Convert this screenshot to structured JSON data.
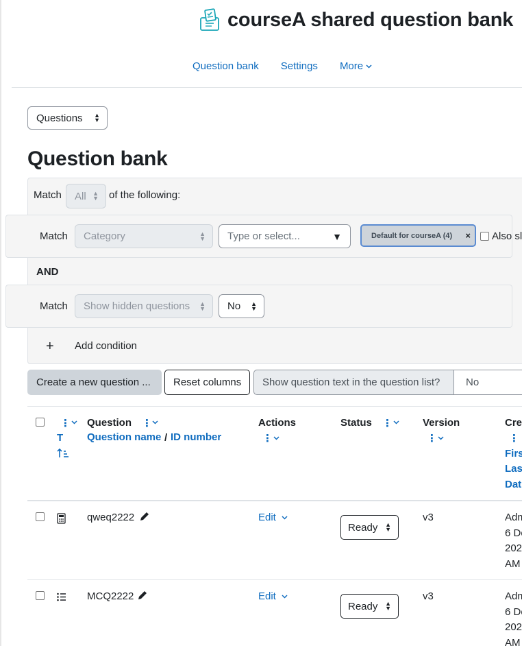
{
  "header": {
    "title": "courseA shared question bank",
    "logo_icon": "question-bank-box-icon"
  },
  "secondary_nav": {
    "items": [
      "Question bank",
      "Settings"
    ],
    "more_label": "More"
  },
  "page_select": {
    "value": "Questions"
  },
  "section_title": "Question bank",
  "filters": {
    "match_label": "Match",
    "match_value": "All",
    "of_following": "of the following:",
    "condition1": {
      "match": "Match",
      "type": "Category",
      "typeahead_placeholder": "Type or select...",
      "chip": "Default for courseA (4)",
      "also_show": "Also sl"
    },
    "join": "AND",
    "condition2": {
      "match": "Match",
      "type": "Show hidden questions",
      "value": "No"
    },
    "add_condition_label": "Add condition"
  },
  "actions": {
    "create_label": "Create a new question ...",
    "reset_label": "Reset columns",
    "show_text_label": "Show question text in the question list?",
    "show_text_value": "No"
  },
  "table": {
    "headers": {
      "type_short": "T",
      "question": "Question",
      "question_name": "Question name",
      "slash": "/",
      "id_number": "ID number",
      "actions": "Actions",
      "status": "Status",
      "version": "Version",
      "created": "Cre",
      "created_sub": [
        "Firs",
        "Las",
        "Dat"
      ]
    },
    "rows": [
      {
        "name": "qweq2222",
        "type_icon": "calculator-icon",
        "action": "Edit",
        "status": "Ready",
        "version": "v3",
        "created": [
          "Adm",
          "6 De",
          "202",
          "AM"
        ]
      },
      {
        "name": "MCQ2222",
        "type_icon": "list-icon",
        "action": "Edit",
        "status": "Ready",
        "version": "v3",
        "created": [
          "Adm",
          "6 De",
          "202",
          "AM"
        ]
      }
    ]
  },
  "colors": {
    "link": "#0f6cbf",
    "text": "#1d2125",
    "chip_border": "#5a8bd1"
  }
}
